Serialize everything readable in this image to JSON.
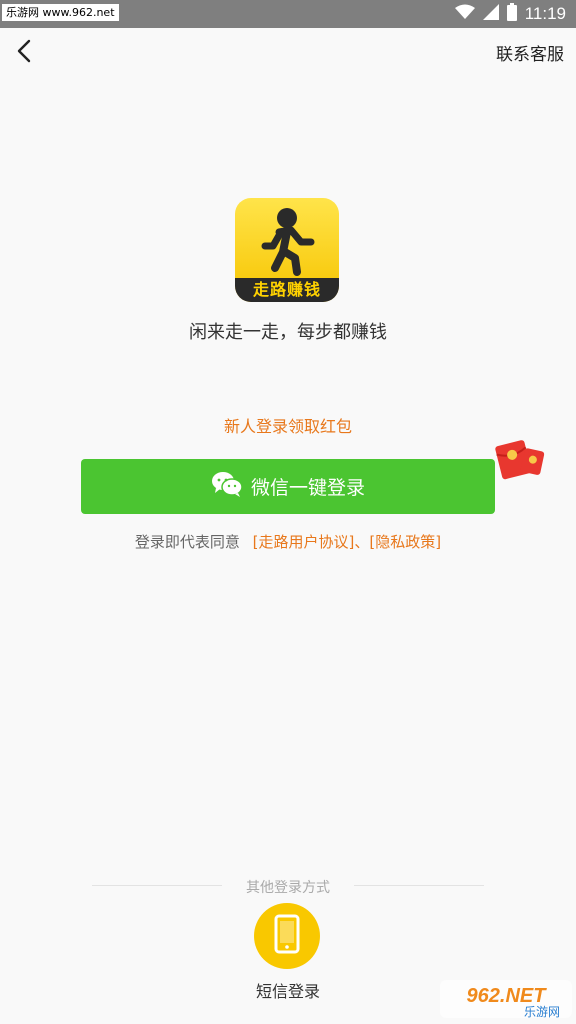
{
  "status_bar": {
    "watermark": "乐游网 www.962.net",
    "time": "11:19",
    "icons": [
      "wifi-icon",
      "signal-icon",
      "battery-icon"
    ]
  },
  "header": {
    "back_icon": "chevron-left-icon",
    "contact_label": "联系客服"
  },
  "logo": {
    "text": "走路赚钱",
    "icon": "walking-person-icon"
  },
  "slogan": "闲来走一走，每步都赚钱",
  "promo_text": "新人登录领取红包",
  "wechat_login": {
    "icon": "wechat-icon",
    "label": "微信一键登录"
  },
  "redpacket_icon": "red-envelope-icon",
  "agreement": {
    "prefix": "登录即代表同意",
    "user_agreement": "[走路用户协议]",
    "separator": "、",
    "privacy_policy": "[隐私政策]"
  },
  "other_login": {
    "label": "其他登录方式",
    "sms_icon": "phone-icon",
    "sms_label": "短信登录"
  },
  "watermark_br": {
    "brand": "962.NET",
    "sub": "乐游网"
  },
  "colors": {
    "accent_green": "#4bc531",
    "accent_orange": "#e8781c",
    "accent_yellow": "#f9c800"
  }
}
